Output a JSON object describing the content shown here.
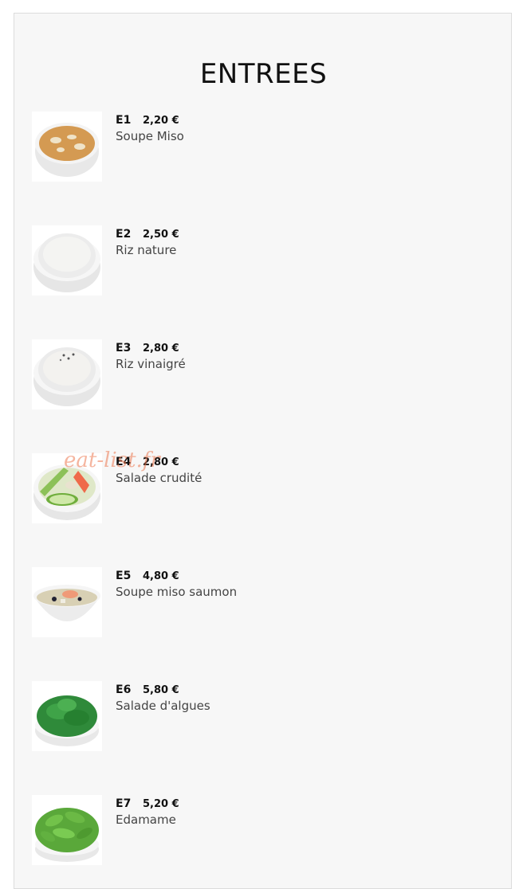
{
  "page": {
    "title": "ENTREES",
    "watermark": "eat-list.fr"
  },
  "items": [
    {
      "code": "E1",
      "price": "2,20 €",
      "name": "Soupe Miso",
      "image": "miso-soup-image",
      "accent": "#d9a25c"
    },
    {
      "code": "E2",
      "price": "2,50 €",
      "name": "Riz nature",
      "image": "plain-rice-image",
      "accent": "#f2f2f2"
    },
    {
      "code": "E3",
      "price": "2,80 €",
      "name": "Riz vinaigré",
      "image": "vinegar-rice-image",
      "accent": "#eeeeee"
    },
    {
      "code": "E4",
      "price": "2,80 €",
      "name": "Salade crudité",
      "image": "raw-salad-image",
      "accent": "#7ab648"
    },
    {
      "code": "E5",
      "price": "4,80 €",
      "name": "Soupe miso saumon",
      "image": "salmon-miso-soup-image",
      "accent": "#d7d2bf"
    },
    {
      "code": "E6",
      "price": "5,80 €",
      "name": "Salade d'algues",
      "image": "seaweed-salad-image",
      "accent": "#2f8a3a"
    },
    {
      "code": "E7",
      "price": "5,20 €",
      "name": "Edamame",
      "image": "edamame-image",
      "accent": "#5aa83a"
    }
  ]
}
